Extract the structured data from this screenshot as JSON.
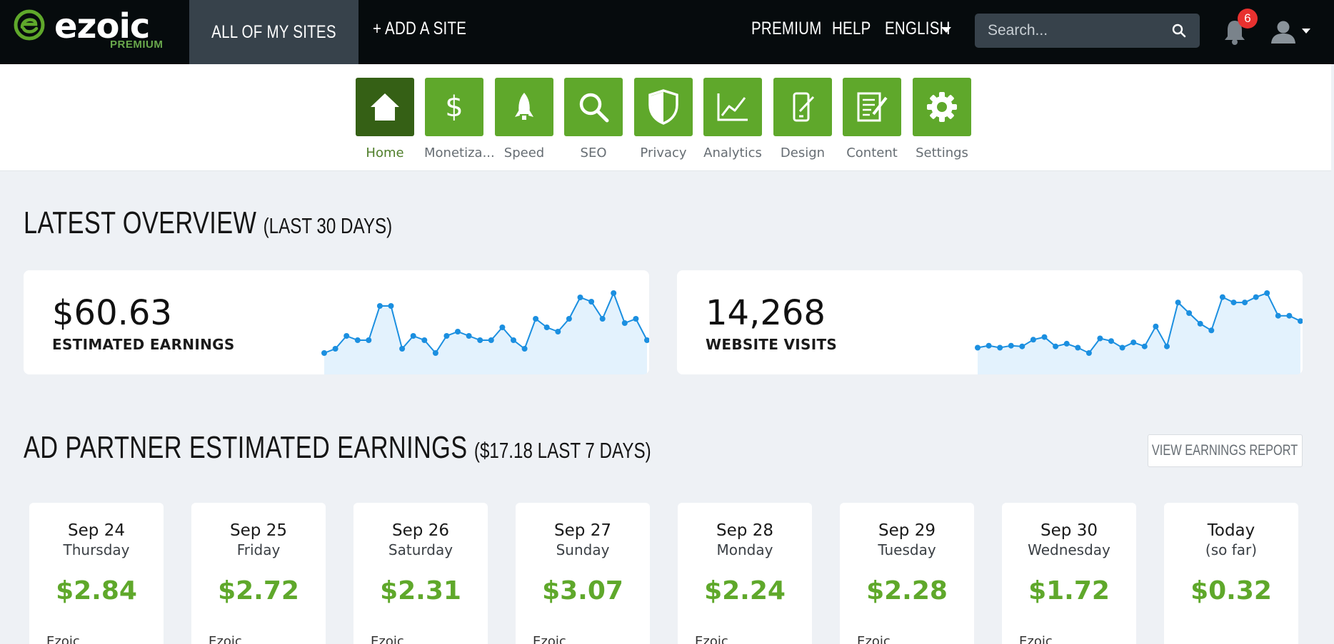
{
  "header": {
    "logo_text": "ezoic",
    "logo_sub": "PREMIUM",
    "active_nav": "ALL OF MY SITES",
    "add_site": "+ ADD A SITE",
    "premium": "PREMIUM",
    "help": "HELP",
    "language": "ENGLISH",
    "search_placeholder": "Search...",
    "notification_count": "6"
  },
  "toolbar": {
    "items": [
      {
        "label": "Home",
        "icon": "home-icon"
      },
      {
        "label": "Monetiza...",
        "icon": "dollar-icon"
      },
      {
        "label": "Speed",
        "icon": "rocket-icon"
      },
      {
        "label": "SEO",
        "icon": "magnifier-icon"
      },
      {
        "label": "Privacy",
        "icon": "shield-icon"
      },
      {
        "label": "Analytics",
        "icon": "line-chart-icon"
      },
      {
        "label": "Design",
        "icon": "mobile-design-icon"
      },
      {
        "label": "Content",
        "icon": "document-edit-icon"
      },
      {
        "label": "Settings",
        "icon": "gear-icon"
      }
    ]
  },
  "overview": {
    "title": "LATEST OVERVIEW",
    "subtitle": "(LAST 30 DAYS)",
    "earnings": {
      "value": "$60.63",
      "label": "ESTIMATED EARNINGS"
    },
    "visits": {
      "value": "14,268",
      "label": "WEBSITE VISITS"
    }
  },
  "chart_data": [
    {
      "type": "area",
      "series": [
        {
          "values": [
            2.0,
            2.1,
            2.4,
            2.3,
            2.3,
            3.1,
            3.1,
            2.1,
            2.4,
            2.3,
            2.0,
            2.4,
            2.5,
            2.4,
            2.3,
            2.3,
            2.6,
            2.3,
            2.1,
            2.8,
            2.6,
            2.5,
            2.8,
            3.3,
            3.2,
            2.8,
            3.4,
            2.7,
            2.8,
            2.3
          ]
        }
      ]
    },
    {
      "type": "area",
      "series": [
        {
          "values": [
            380,
            395,
            380,
            395,
            390,
            440,
            460,
            390,
            410,
            380,
            340,
            450,
            430,
            380,
            420,
            390,
            540,
            390,
            720,
            640,
            560,
            510,
            760,
            720,
            720,
            760,
            790,
            620,
            620,
            580
          ]
        }
      ]
    }
  ],
  "ad_partner": {
    "title": "AD PARTNER ESTIMATED EARNINGS",
    "subtitle": "($17.18 LAST 7 DAYS)",
    "report_button": "VIEW EARNINGS REPORT",
    "days": [
      {
        "date": "Sep 24",
        "weekday": "Thursday",
        "amount": "$2.84",
        "partner": "Ezoic"
      },
      {
        "date": "Sep 25",
        "weekday": "Friday",
        "amount": "$2.72",
        "partner": "Ezoic"
      },
      {
        "date": "Sep 26",
        "weekday": "Saturday",
        "amount": "$2.31",
        "partner": "Ezoic"
      },
      {
        "date": "Sep 27",
        "weekday": "Sunday",
        "amount": "$3.07",
        "partner": "Ezoic"
      },
      {
        "date": "Sep 28",
        "weekday": "Monday",
        "amount": "$2.24",
        "partner": "Ezoic"
      },
      {
        "date": "Sep 29",
        "weekday": "Tuesday",
        "amount": "$2.28",
        "partner": "Ezoic"
      },
      {
        "date": "Sep 30",
        "weekday": "Wednesday",
        "amount": "$1.72",
        "partner": "Ezoic"
      },
      {
        "date": "Today",
        "weekday": "(so far)",
        "amount": "$0.32",
        "partner": ""
      }
    ]
  },
  "colors": {
    "brand_green": "#5fa82b",
    "brand_dark_green": "#356015",
    "topbar": "#060b0d",
    "chart_line": "#1b8fe0",
    "chart_fill": "#e3f2fd"
  }
}
